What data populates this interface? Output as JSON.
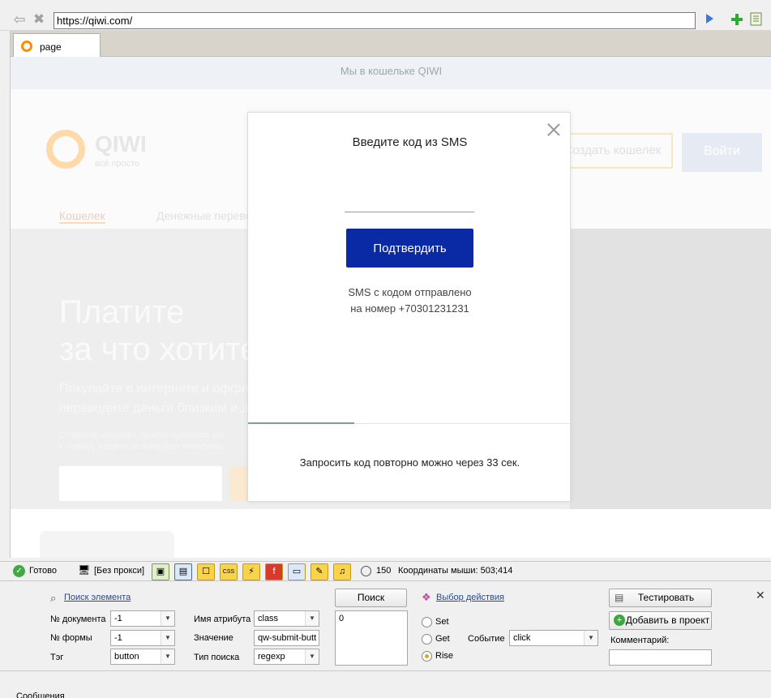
{
  "browser": {
    "url": "https://qiwi.com/",
    "tab_label": "page"
  },
  "background_page": {
    "notice": "Мы в кошельке QIWI",
    "logo_text": "QIWI",
    "logo_sub": "всё просто",
    "create_wallet": "Создать кошелек",
    "login": "Войти",
    "nav_item_1": "Кошелек",
    "nav_item_2": "Денежные переводы",
    "hero_title_1": "Платите",
    "hero_title_2": "за что хотите",
    "hero_text_1": "Покупайте в интернете и оффлайн,",
    "hero_text_2": "переводите деньги близким и друзьям",
    "hero_small_1": "Создайте кошелек, просто привязав его",
    "hero_small_2": "к номеру вашего мобильного телефона"
  },
  "modal": {
    "title": "Введите код из SMS",
    "input_value": "",
    "confirm_label": "Подтвердить",
    "sms_sent_line1": "SMS с кодом отправлено",
    "sms_sent_line2": "на номер +70301231231",
    "resend_text": "Запросить код повторно можно через 33 сек."
  },
  "statusbar": {
    "ready": "Готово",
    "proxy": "[Без прокси]",
    "counter": "150",
    "mouse_coords": "Координаты мыши: 503;414"
  },
  "panel": {
    "find_element": "Поиск элемента",
    "doc_number_label": "№ документа",
    "doc_number_value": "-1",
    "form_number_label": "№ формы",
    "form_number_value": "-1",
    "tag_label": "Тэг",
    "tag_value": "button",
    "attr_name_label": "Имя атрибута",
    "attr_name_value": "class",
    "value_label": "Значение",
    "value_value": "qw-submit-butt",
    "search_type_label": "Тип поиска",
    "search_type_value": "regexp",
    "search_button": "Поиск",
    "result_value": "0",
    "action_choice": "Выбор действия",
    "radio_set": "Set",
    "radio_get": "Get",
    "radio_rise": "Rise",
    "event_label": "Событие",
    "event_value": "click",
    "test_button": "Тестировать",
    "add_to_project_button": "Добавить в проект",
    "comment_label": "Комментарий:",
    "comment_value": ""
  },
  "messages": {
    "label": "Сообщения"
  },
  "colors": {
    "confirm_button": "#0a2aa5",
    "qiwi_orange": "#ff8c00",
    "ready_green": "#43a843",
    "toolbar_yellow": "#f9d44a"
  }
}
